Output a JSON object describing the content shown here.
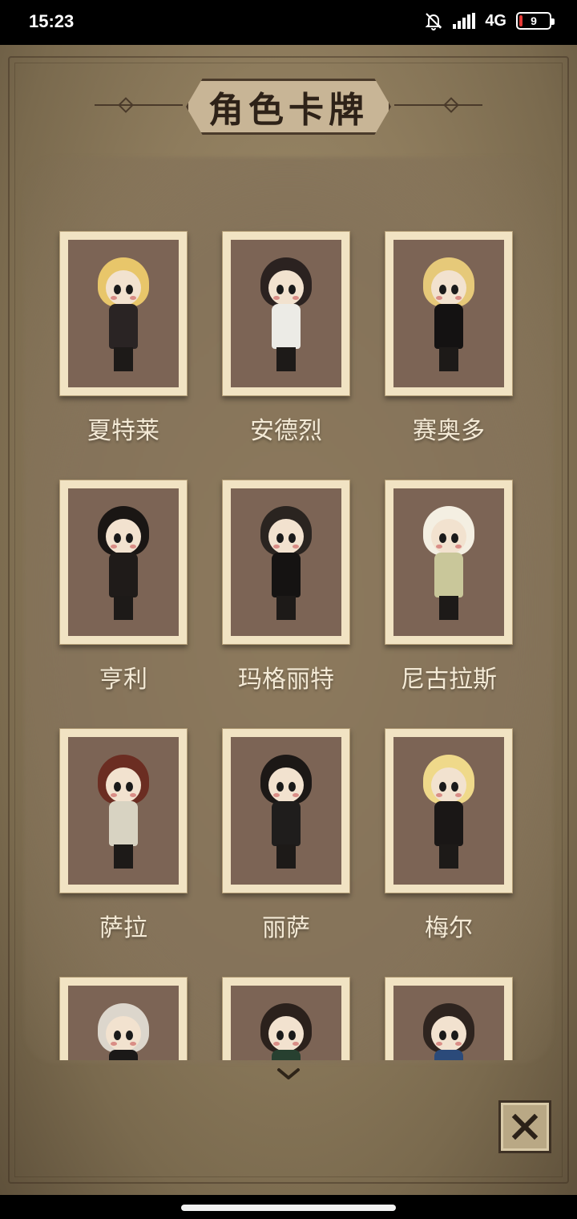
{
  "status_bar": {
    "time": "15:23",
    "network": "4G",
    "battery": "9",
    "battery_level": 0.09,
    "icons": [
      "bell-muted-icon",
      "signal-icon",
      "battery-icon"
    ]
  },
  "panel": {
    "title": "角色卡牌"
  },
  "characters": [
    {
      "name": "夏特莱",
      "hair": "#e8c66a",
      "outfit": "#2a2424"
    },
    {
      "name": "安德烈",
      "hair": "#2b2220",
      "outfit": "#ecebe6"
    },
    {
      "name": "赛奥多",
      "hair": "#e6c979",
      "outfit": "#141212"
    },
    {
      "name": "亨利",
      "hair": "#1a1614",
      "outfit": "#1f1b19"
    },
    {
      "name": "玛格丽特",
      "hair": "#2a2420",
      "outfit": "#151312"
    },
    {
      "name": "尼古拉斯",
      "hair": "#f4efe2",
      "outfit": "#c9c79a"
    },
    {
      "name": "萨拉",
      "hair": "#6b2d22",
      "outfit": "#d8d3c2"
    },
    {
      "name": "丽萨",
      "hair": "#1c1816",
      "outfit": "#1f1d1c"
    },
    {
      "name": "梅尔",
      "hair": "#efd98a",
      "outfit": "#1a1716"
    },
    {
      "name": "",
      "hair": "#dcd6cc",
      "outfit": "#1b1918"
    },
    {
      "name": "",
      "hair": "#2b211c",
      "outfit": "#274030"
    },
    {
      "name": "",
      "hair": "#2e241f",
      "outfit": "#2b4a7a"
    }
  ],
  "controls": {
    "more_icon": "chevron-down-icon",
    "close_icon": "close-icon"
  }
}
